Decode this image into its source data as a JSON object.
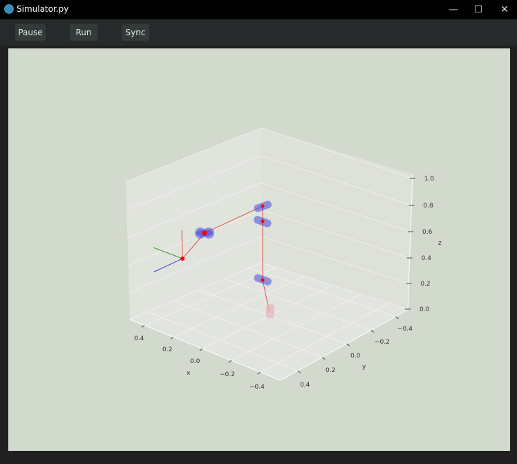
{
  "window": {
    "title": "Simulator.py",
    "minimize": "—",
    "maximize": "☐",
    "close": "✕"
  },
  "toolbar": {
    "pause": "Pause",
    "run": "Run",
    "sync": "Sync"
  },
  "plot": {
    "x_label": "x",
    "y_label": "y",
    "z_label": "z",
    "x_ticks": [
      "0.4",
      "0.2",
      "0.0",
      "−0.2",
      "−0.4"
    ],
    "y_ticks": [
      "−0.4",
      "−0.2",
      "0.0",
      "0.2",
      "0.4"
    ],
    "z_ticks": [
      "1.0",
      "0.8",
      "0.6",
      "0.4",
      "0.2",
      "0.0"
    ],
    "colors": {
      "link": "#e05050",
      "joint": "#3a3adf",
      "joint_center": "#ff0000",
      "base": "#e8b8bd"
    }
  }
}
